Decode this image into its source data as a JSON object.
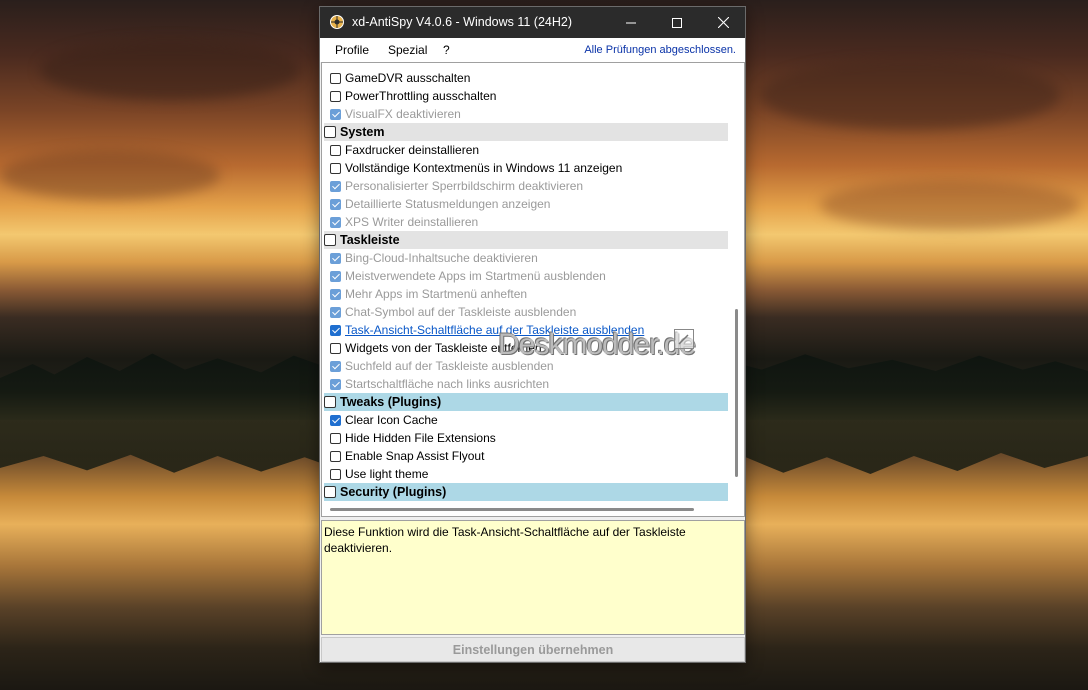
{
  "window": {
    "title": "xd-AntiSpy V4.0.6 - Windows 11 (24H2)"
  },
  "menu": {
    "items": [
      "Profile",
      "Spezial",
      "?"
    ],
    "status": "Alle Prüfungen abgeschlossen."
  },
  "list": {
    "rows": [
      {
        "type": "item",
        "label": "GameDVR ausschalten",
        "checked": false,
        "dim": false
      },
      {
        "type": "item",
        "label": "PowerThrottling ausschalten",
        "checked": false,
        "dim": false
      },
      {
        "type": "item",
        "label": "VisualFX deaktivieren",
        "checked": true,
        "dim": true
      },
      {
        "type": "group",
        "label": "System",
        "color": "gray"
      },
      {
        "type": "item",
        "label": "Faxdrucker deinstallieren",
        "checked": false,
        "dim": false
      },
      {
        "type": "item",
        "label": "Vollständige Kontextmenüs in Windows 11 anzeigen",
        "checked": false,
        "dim": false
      },
      {
        "type": "item",
        "label": "Personalisierter Sperrbildschirm deaktivieren",
        "checked": true,
        "dim": true
      },
      {
        "type": "item",
        "label": "Detaillierte Statusmeldungen anzeigen",
        "checked": true,
        "dim": true
      },
      {
        "type": "item",
        "label": "XPS Writer deinstallieren",
        "checked": true,
        "dim": true
      },
      {
        "type": "group",
        "label": "Taskleiste",
        "color": "gray"
      },
      {
        "type": "item",
        "label": "Bing-Cloud-Inhaltsuche deaktivieren",
        "checked": true,
        "dim": true
      },
      {
        "type": "item",
        "label": "Meistverwendete Apps im Startmenü ausblenden",
        "checked": true,
        "dim": true
      },
      {
        "type": "item",
        "label": "Mehr Apps im Startmenü anheften",
        "checked": true,
        "dim": true
      },
      {
        "type": "item",
        "label": "Chat-Symbol auf der Taskleiste ausblenden",
        "checked": true,
        "dim": true
      },
      {
        "type": "item",
        "label": "Task-Ansicht-Schaltfläche auf der Taskleiste ausblenden",
        "checked": true,
        "dim": false,
        "link": true
      },
      {
        "type": "item",
        "label": "Widgets von der Taskleiste entfernen",
        "checked": false,
        "dim": false
      },
      {
        "type": "item",
        "label": "Suchfeld auf der Taskleiste ausblenden",
        "checked": true,
        "dim": true
      },
      {
        "type": "item",
        "label": "Startschaltfläche nach links ausrichten",
        "checked": true,
        "dim": true
      },
      {
        "type": "group",
        "label": "Tweaks (Plugins)",
        "color": "blue"
      },
      {
        "type": "item",
        "label": "Clear Icon Cache",
        "checked": true,
        "dim": false
      },
      {
        "type": "item",
        "label": "Hide Hidden File Extensions",
        "checked": false,
        "dim": false
      },
      {
        "type": "item",
        "label": "Enable Snap Assist Flyout",
        "checked": false,
        "dim": false
      },
      {
        "type": "item",
        "label": "Use light theme",
        "checked": false,
        "dim": false
      },
      {
        "type": "group",
        "label": "Security (Plugins)",
        "color": "blue"
      }
    ]
  },
  "watermark": "Deskmodder.de",
  "description": "Diese Funktion wird die Task-Ansicht-Schaltfläche auf der Taskleiste deaktivieren.",
  "apply_label": "Einstellungen übernehmen"
}
